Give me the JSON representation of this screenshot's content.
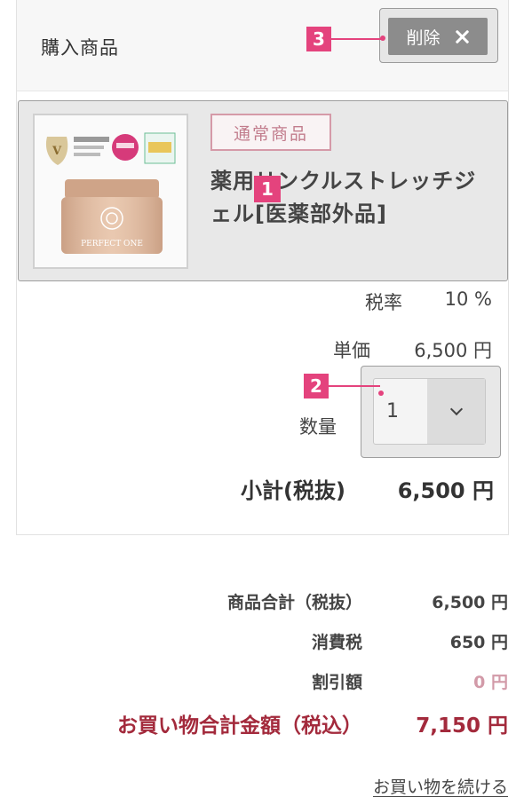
{
  "cart": {
    "title": "購入商品",
    "delete_label": "削除",
    "product": {
      "tag": "通常商品",
      "name": "薬用リンクルストレッチジェル[医薬部外品]",
      "image_brand_text": "PERFECT ONE"
    },
    "tax_rate_label": "税率",
    "tax_rate_value": "10 %",
    "unit_price_label": "単価",
    "unit_price_value": "6,500 円",
    "quantity_label": "数量",
    "quantity_value": "1",
    "subtotal_label": "小計(税抜)",
    "subtotal_value": "6,500 円"
  },
  "summary": {
    "rows": [
      {
        "label": "商品合計（税抜）",
        "value": "6,500 円"
      },
      {
        "label": "消費税",
        "value": "650 円"
      },
      {
        "label": "割引額",
        "value": "0 円"
      }
    ],
    "total_label": "お買い物合計金額（税込）",
    "total_value": "7,150 円"
  },
  "continue_link": "お買い物を続ける",
  "markers": [
    "1",
    "2",
    "3"
  ],
  "colors": {
    "marker": "#e4437d",
    "total_text": "#a32a3c",
    "discount_text": "#d29aa8",
    "tag_border": "#d59aa8",
    "delete_button": "#8c8c8c"
  }
}
